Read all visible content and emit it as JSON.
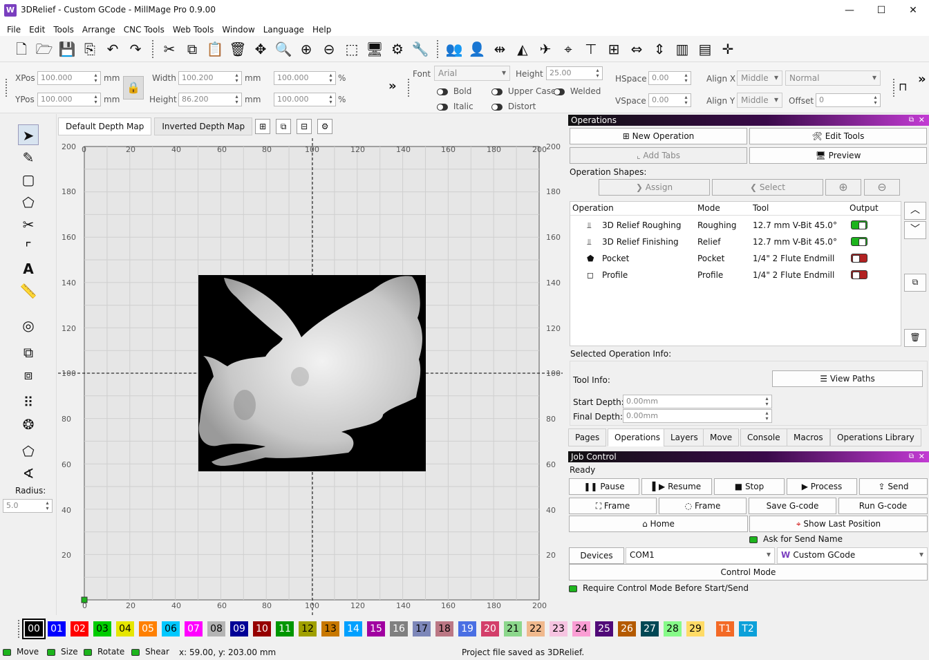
{
  "window": {
    "title": "3DRelief - Custom GCode - MillMage Pro 0.9.00",
    "minimize": "—",
    "maximize": "☐",
    "close": "✕"
  },
  "menu": [
    "File",
    "Edit",
    "Tools",
    "Arrange",
    "CNC Tools",
    "Web Tools",
    "Window",
    "Language",
    "Help"
  ],
  "properties": {
    "xpos_label": "XPos",
    "xpos": "100.000",
    "ypos_label": "YPos",
    "ypos": "100.000",
    "unit": "mm",
    "width_label": "Width",
    "width": "100.200",
    "height_label": "Height",
    "height": "86.200",
    "width_pct": "100.000",
    "height_pct": "100.000",
    "pct": "%",
    "font_label": "Font",
    "font": "Arial",
    "font_height_label": "Height",
    "font_height": "25.00",
    "bold": "Bold",
    "italic": "Italic",
    "upper_case": "Upper Case",
    "welded": "Welded",
    "distort": "Distort",
    "hspace_label": "HSpace",
    "hspace": "0.00",
    "vspace_label": "VSpace",
    "vspace": "0.00",
    "alignx_label": "Align X",
    "alignx": "Middle",
    "aligny_label": "Align Y",
    "aligny": "Middle",
    "style": "Normal",
    "offset_label": "Offset",
    "offset": "0",
    "more": "»"
  },
  "left_tools": {
    "radius_label": "Radius:",
    "radius": "5.0",
    "text_tool": "A"
  },
  "doc_tabs": [
    "Default Depth Map",
    "Inverted Depth Map"
  ],
  "ruler": {
    "x": [
      "0",
      "20",
      "40",
      "60",
      "80",
      "100",
      "120",
      "140",
      "160",
      "180",
      "200"
    ],
    "y": [
      "200",
      "180",
      "160",
      "140",
      "120",
      "100",
      "80",
      "60",
      "40",
      "20"
    ]
  },
  "operations": {
    "panel_title": "Operations",
    "new_operation": "New Operation",
    "edit_tools": "Edit Tools",
    "add_tabs": "Add Tabs",
    "preview": "Preview",
    "shapes_label": "Operation Shapes:",
    "assign": "Assign",
    "select": "Select",
    "columns": [
      "Operation",
      "Mode",
      "Tool",
      "Output"
    ],
    "rows": [
      {
        "name": "3D Relief Roughing",
        "mode": "Roughing",
        "tool": "12.7 mm V-Bit 45.0°",
        "output": "on"
      },
      {
        "name": "3D Relief Finishing",
        "mode": "Relief",
        "tool": "12.7 mm V-Bit 45.0°",
        "output": "on"
      },
      {
        "name": "Pocket",
        "mode": "Pocket",
        "tool": "1/4\" 2 Flute Endmill",
        "output": "off"
      },
      {
        "name": "Profile",
        "mode": "Profile",
        "tool": "1/4\" 2 Flute Endmill",
        "output": "off"
      }
    ],
    "selected_info": "Selected Operation Info:",
    "tool_info": "Tool Info:",
    "view_paths": "View Paths",
    "start_depth_label": "Start Depth:",
    "start_depth": "0.00mm",
    "final_depth_label": "Final Depth:",
    "final_depth": "0.00mm",
    "tabs": [
      "Pages",
      "Operations",
      "Layers",
      "Move",
      "Console",
      "Macros",
      "Operations Library"
    ]
  },
  "job": {
    "panel_title": "Job Control",
    "status": "Ready",
    "pause": "Pause",
    "resume": "Resume",
    "stop": "Stop",
    "process": "Process",
    "send": "Send",
    "frame1": "Frame",
    "frame2": "Frame",
    "save_gcode": "Save G-code",
    "run_gcode": "Run G-code",
    "home": "Home",
    "show_last": "Show Last Position",
    "ask_send": "Ask for Send Name",
    "devices": "Devices",
    "port": "COM1",
    "device": "Custom GCode",
    "control_mode": "Control Mode",
    "require_control": "Require Control Mode Before Start/Send"
  },
  "palette": [
    {
      "label": "00",
      "bg": "#000000",
      "fg": "#ffffff"
    },
    {
      "label": "01",
      "bg": "#0000ff",
      "fg": "#ffffff"
    },
    {
      "label": "02",
      "bg": "#ff0000",
      "fg": "#ffffff"
    },
    {
      "label": "03",
      "bg": "#00cc00",
      "fg": "#000000"
    },
    {
      "label": "04",
      "bg": "#e6e600",
      "fg": "#000000"
    },
    {
      "label": "05",
      "bg": "#ff8000",
      "fg": "#ffffff"
    },
    {
      "label": "06",
      "bg": "#00c8ff",
      "fg": "#000000"
    },
    {
      "label": "07",
      "bg": "#ff00ff",
      "fg": "#ffffff"
    },
    {
      "label": "08",
      "bg": "#b4b4b4",
      "fg": "#000000"
    },
    {
      "label": "09",
      "bg": "#000096",
      "fg": "#ffffff"
    },
    {
      "label": "10",
      "bg": "#960000",
      "fg": "#ffffff"
    },
    {
      "label": "11",
      "bg": "#009600",
      "fg": "#ffffff"
    },
    {
      "label": "12",
      "bg": "#a0a000",
      "fg": "#000000"
    },
    {
      "label": "13",
      "bg": "#c87800",
      "fg": "#000000"
    },
    {
      "label": "14",
      "bg": "#00a0ff",
      "fg": "#ffffff"
    },
    {
      "label": "15",
      "bg": "#a000a0",
      "fg": "#ffffff"
    },
    {
      "label": "16",
      "bg": "#808080",
      "fg": "#ffffff"
    },
    {
      "label": "17",
      "bg": "#7d87b9",
      "fg": "#000000"
    },
    {
      "label": "18",
      "bg": "#bb7784",
      "fg": "#000000"
    },
    {
      "label": "19",
      "bg": "#4a6fe3",
      "fg": "#ffffff"
    },
    {
      "label": "20",
      "bg": "#d33f6a",
      "fg": "#ffffff"
    },
    {
      "label": "21",
      "bg": "#8cd78c",
      "fg": "#000000"
    },
    {
      "label": "22",
      "bg": "#f0b98d",
      "fg": "#000000"
    },
    {
      "label": "23",
      "bg": "#f6c4e1",
      "fg": "#000000"
    },
    {
      "label": "24",
      "bg": "#fa9ed4",
      "fg": "#000000"
    },
    {
      "label": "25",
      "bg": "#500a78",
      "fg": "#ffffff"
    },
    {
      "label": "26",
      "bg": "#b45a00",
      "fg": "#ffffff"
    },
    {
      "label": "27",
      "bg": "#004754",
      "fg": "#ffffff"
    },
    {
      "label": "28",
      "bg": "#86fa88",
      "fg": "#000000"
    },
    {
      "label": "29",
      "bg": "#ffdb66",
      "fg": "#000000"
    },
    {
      "label": "T1",
      "bg": "#f36926",
      "fg": "#ffffff"
    },
    {
      "label": "T2",
      "bg": "#0ca0d9",
      "fg": "#ffffff"
    }
  ],
  "status": {
    "move": "Move",
    "size": "Size",
    "rotate": "Rotate",
    "shear": "Shear",
    "coords": "x: 59.00, y: 203.00 mm",
    "message": "Project file saved as 3DRelief."
  }
}
